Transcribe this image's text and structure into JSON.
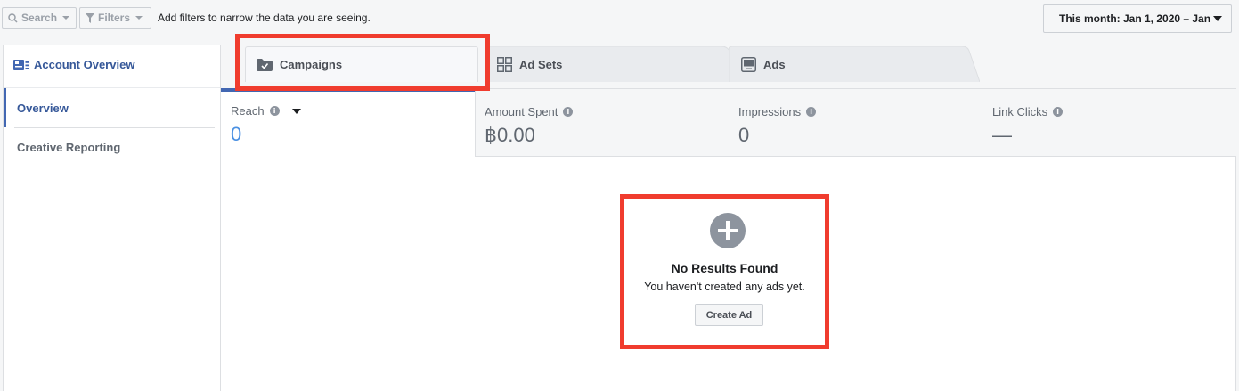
{
  "topbar": {
    "search_label": "Search",
    "filters_label": "Filters",
    "hint": "Add filters to narrow the data you are seeing.",
    "date_range": "This month: Jan 1, 2020 – Jan"
  },
  "sidebar": {
    "account_overview": "Account Overview",
    "items": [
      {
        "label": "Overview",
        "active": true
      },
      {
        "label": "Creative Reporting",
        "active": false
      }
    ]
  },
  "tabs": [
    {
      "label": "Campaigns",
      "icon": "folder-check-icon"
    },
    {
      "label": "Ad Sets",
      "icon": "grid-icon"
    },
    {
      "label": "Ads",
      "icon": "ad-icon"
    }
  ],
  "metrics": [
    {
      "label": "Reach",
      "value": "0"
    },
    {
      "label": "Amount Spent",
      "value": "฿0.00"
    },
    {
      "label": "Impressions",
      "value": "0"
    },
    {
      "label": "Link Clicks",
      "value": "—"
    }
  ],
  "empty_state": {
    "title": "No Results Found",
    "subtitle": "You haven't created any ads yet.",
    "button": "Create Ad"
  },
  "colors": {
    "accent": "#4267b2",
    "link": "#365899",
    "highlight": "#f03c2e",
    "reach_value": "#4a90e2"
  }
}
